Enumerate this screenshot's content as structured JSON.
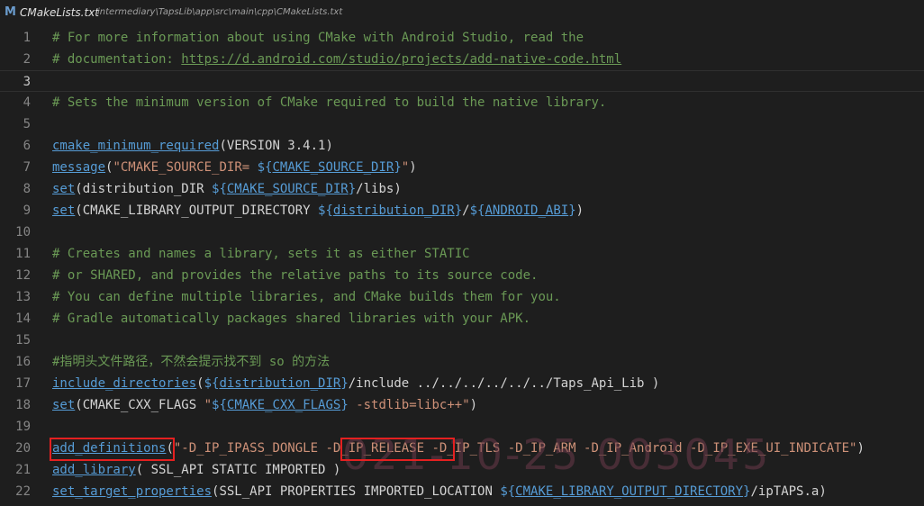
{
  "tab": {
    "icon": "M",
    "filename": "CMakeLists.txt",
    "path": "intermediary\\TapsLib\\app\\src\\main\\cpp\\CMakeLists.txt"
  },
  "watermark": "021-10-25 003045",
  "colors": {
    "background": "#1e1e1e",
    "comment": "#6a9955",
    "function": "#569cd6",
    "string": "#ce9178",
    "text": "#d4d4d4",
    "highlight": "#e52020"
  },
  "lines": [
    {
      "n": "1",
      "tokens": [
        {
          "t": "# For more information about using CMake with Android Studio, read the",
          "c": "comment"
        }
      ]
    },
    {
      "n": "2",
      "tokens": [
        {
          "t": "# documentation: ",
          "c": "comment"
        },
        {
          "t": "https://d.android.com/studio/projects/add-native-code.html",
          "c": "link"
        }
      ]
    },
    {
      "n": "3",
      "tokens": []
    },
    {
      "n": "4",
      "tokens": [
        {
          "t": "# Sets the minimum version of CMake required to build the native library.",
          "c": "comment"
        }
      ]
    },
    {
      "n": "5",
      "tokens": []
    },
    {
      "n": "6",
      "tokens": [
        {
          "t": "cmake_minimum_required",
          "c": "fn"
        },
        {
          "t": "(VERSION 3.4.1)",
          "c": "plain"
        }
      ]
    },
    {
      "n": "7",
      "tokens": [
        {
          "t": "message",
          "c": "fn"
        },
        {
          "t": "(",
          "c": "plain"
        },
        {
          "t": "\"CMAKE_SOURCE_DIR= ",
          "c": "str"
        },
        {
          "t": "${",
          "c": "var"
        },
        {
          "t": "CMAKE_SOURCE_DIR",
          "c": "fn"
        },
        {
          "t": "}",
          "c": "var"
        },
        {
          "t": "\"",
          "c": "str"
        },
        {
          "t": ")",
          "c": "plain"
        }
      ]
    },
    {
      "n": "8",
      "tokens": [
        {
          "t": "set",
          "c": "fn"
        },
        {
          "t": "(distribution_DIR ",
          "c": "plain"
        },
        {
          "t": "${",
          "c": "var"
        },
        {
          "t": "CMAKE_SOURCE_DIR",
          "c": "fn"
        },
        {
          "t": "}",
          "c": "var"
        },
        {
          "t": "/libs)",
          "c": "plain"
        }
      ]
    },
    {
      "n": "9",
      "tokens": [
        {
          "t": "set",
          "c": "fn"
        },
        {
          "t": "(CMAKE_LIBRARY_OUTPUT_DIRECTORY ",
          "c": "plain"
        },
        {
          "t": "${",
          "c": "var"
        },
        {
          "t": "distribution_DIR",
          "c": "fn"
        },
        {
          "t": "}",
          "c": "var"
        },
        {
          "t": "/",
          "c": "plain"
        },
        {
          "t": "${",
          "c": "var"
        },
        {
          "t": "ANDROID_ABI",
          "c": "fn"
        },
        {
          "t": "}",
          "c": "var"
        },
        {
          "t": ")",
          "c": "plain"
        }
      ]
    },
    {
      "n": "10",
      "tokens": []
    },
    {
      "n": "11",
      "tokens": [
        {
          "t": "# Creates and names a library, sets it as either STATIC",
          "c": "comment"
        }
      ]
    },
    {
      "n": "12",
      "tokens": [
        {
          "t": "# or SHARED, and provides the relative paths to its source code.",
          "c": "comment"
        }
      ]
    },
    {
      "n": "13",
      "tokens": [
        {
          "t": "# You can define multiple libraries, and CMake builds them for you.",
          "c": "comment"
        }
      ]
    },
    {
      "n": "14",
      "tokens": [
        {
          "t": "# Gradle automatically packages shared libraries with your APK.",
          "c": "comment"
        }
      ]
    },
    {
      "n": "15",
      "tokens": []
    },
    {
      "n": "16",
      "tokens": [
        {
          "t": "#指明头文件路径，不然会提示找不到 so 的方法",
          "c": "comment"
        }
      ]
    },
    {
      "n": "17",
      "tokens": [
        {
          "t": "include_directories",
          "c": "fn"
        },
        {
          "t": "(",
          "c": "plain"
        },
        {
          "t": "${",
          "c": "var"
        },
        {
          "t": "distribution_DIR",
          "c": "fn"
        },
        {
          "t": "}",
          "c": "var"
        },
        {
          "t": "/include ../../../../../../Taps_Api_Lib )",
          "c": "plain"
        }
      ]
    },
    {
      "n": "18",
      "tokens": [
        {
          "t": "set",
          "c": "fn"
        },
        {
          "t": "(CMAKE_CXX_FLAGS ",
          "c": "plain"
        },
        {
          "t": "\"",
          "c": "str"
        },
        {
          "t": "${",
          "c": "var"
        },
        {
          "t": "CMAKE_CXX_FLAGS",
          "c": "fn"
        },
        {
          "t": "}",
          "c": "var"
        },
        {
          "t": " -stdlib=libc++\"",
          "c": "str"
        },
        {
          "t": ")",
          "c": "plain"
        }
      ]
    },
    {
      "n": "19",
      "tokens": []
    },
    {
      "n": "20",
      "tokens": [
        {
          "t": "add_definitions",
          "c": "fn"
        },
        {
          "t": "(",
          "c": "plain"
        },
        {
          "t": "\"-D_IP_IPASS_DONGLE -D_IP_RELEASE -D_IP_TLS -D_IP_ARM -D_IP_Android -D_IP_EXE_UI_INDICATE\"",
          "c": "str"
        },
        {
          "t": ")",
          "c": "plain"
        }
      ]
    },
    {
      "n": "21",
      "tokens": [
        {
          "t": "add_library",
          "c": "fn"
        },
        {
          "t": "( SSL_API STATIC IMPORTED )",
          "c": "plain"
        }
      ]
    },
    {
      "n": "22",
      "tokens": [
        {
          "t": "set_target_properties",
          "c": "fn"
        },
        {
          "t": "(SSL_API PROPERTIES IMPORTED_LOCATION ",
          "c": "plain"
        },
        {
          "t": "${",
          "c": "var"
        },
        {
          "t": "CMAKE_LIBRARY_OUTPUT_DIRECTORY",
          "c": "fn"
        },
        {
          "t": "}",
          "c": "var"
        },
        {
          "t": "/ipTAPS.a)",
          "c": "plain"
        }
      ]
    }
  ]
}
